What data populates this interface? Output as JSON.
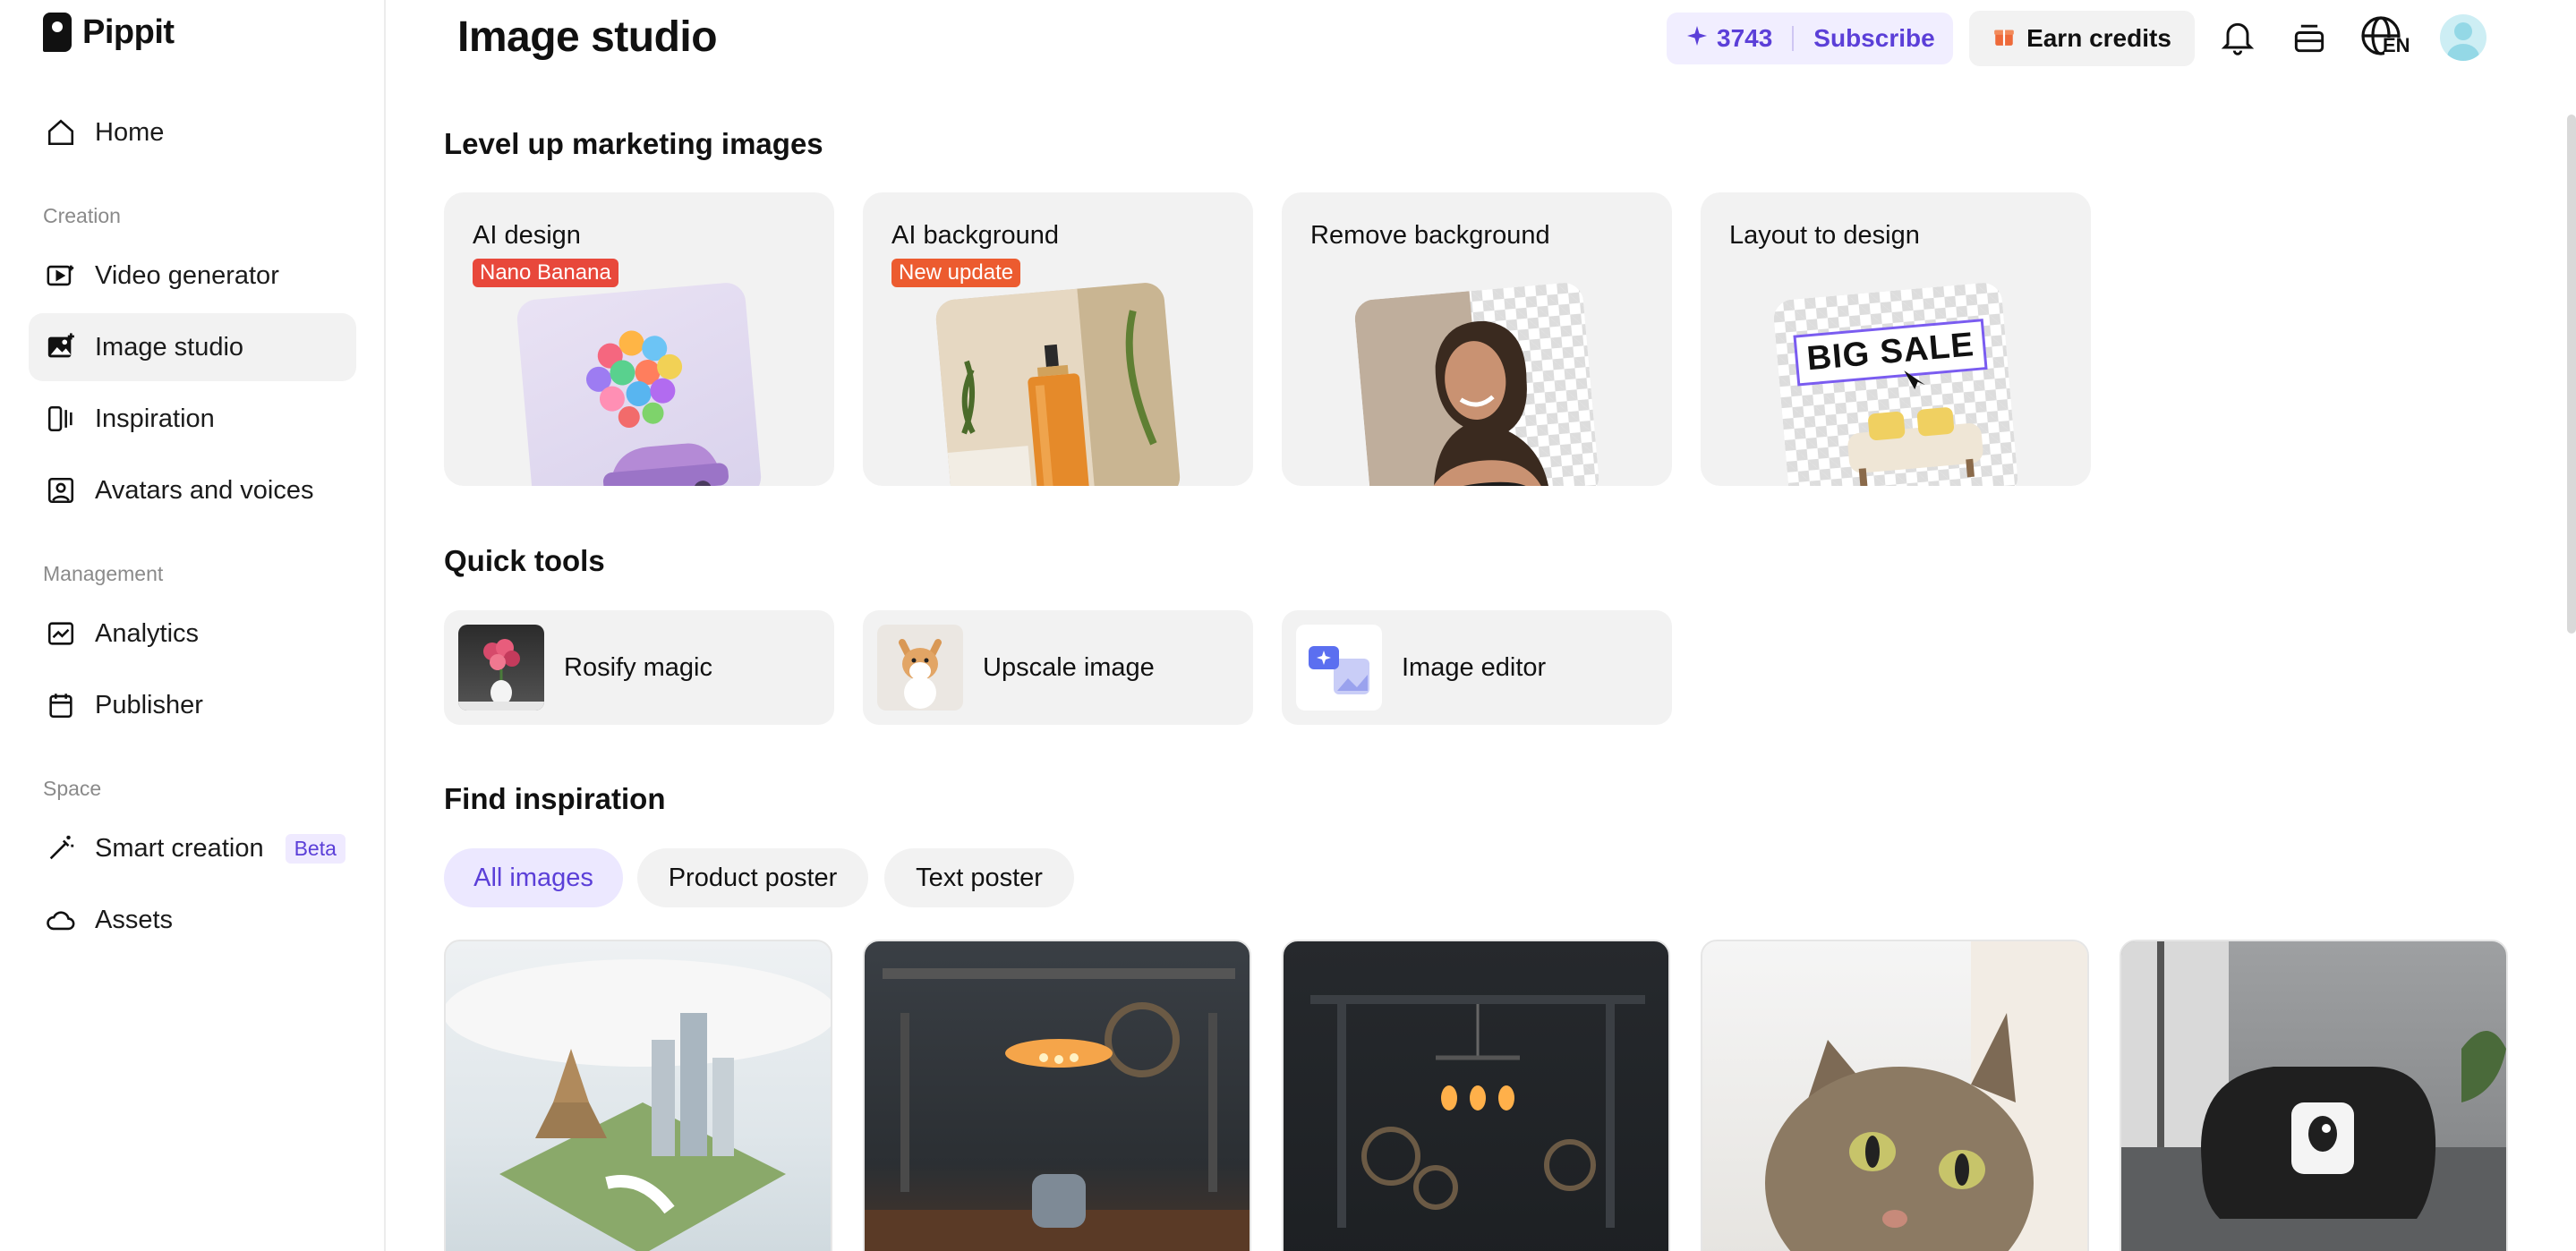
{
  "brand": {
    "name": "Pippit"
  },
  "sidebar": {
    "home": "Home",
    "sections": {
      "creation": "Creation",
      "management": "Management",
      "space": "Space"
    },
    "items": {
      "video_generator": "Video generator",
      "image_studio": "Image studio",
      "inspiration": "Inspiration",
      "avatars": "Avatars and voices",
      "analytics": "Analytics",
      "publisher": "Publisher",
      "smart_creation": "Smart creation",
      "assets": "Assets"
    },
    "beta_badge": "Beta",
    "active_item": "image_studio"
  },
  "header": {
    "title": "Image studio",
    "credits": "3743",
    "subscribe": "Subscribe",
    "earn_credits": "Earn credits",
    "language": "EN"
  },
  "marketing": {
    "title": "Level up marketing images",
    "cards": [
      {
        "title": "AI design",
        "badge": "Nano Banana"
      },
      {
        "title": "AI background",
        "badge": "New update"
      },
      {
        "title": "Remove background"
      },
      {
        "title": "Layout to design",
        "thumb_text": "BIG SALE"
      }
    ]
  },
  "quick_tools": {
    "title": "Quick tools",
    "items": [
      "Rosify magic",
      "Upscale image",
      "Image editor"
    ]
  },
  "inspiration": {
    "title": "Find inspiration",
    "filters": [
      "All images",
      "Product poster",
      "Text poster"
    ],
    "active_filter": "All images"
  },
  "colors": {
    "accent": "#5b3fd8",
    "badge_red": "#e8483b",
    "card_bg": "#f2f2f2"
  }
}
